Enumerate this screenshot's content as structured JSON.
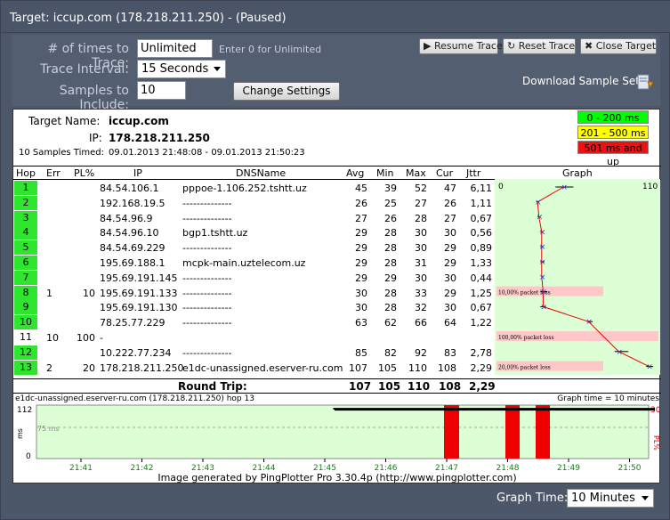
{
  "title": "Target: iccup.com (178.218.211.250) - (Paused)",
  "controls": {
    "times_label": "# of times to Trace:",
    "times_value": "Unlimited",
    "times_hint": "Enter 0 for Unlimited",
    "interval_label": "Trace Interval:",
    "interval_value": "15 Seconds",
    "samples_label": "Samples to Include:",
    "samples_value": "10",
    "change_settings": "Change Settings",
    "resume_trace": "Resume Trace",
    "reset_trace": "Reset Trace",
    "close_target": "Close Target",
    "download_sample": "Download Sample Set"
  },
  "header": {
    "target_name_label": "Target Name:",
    "target_name": "iccup.com",
    "ip_label": "IP:",
    "ip": "178.218.211.250",
    "samples_timed": "10 Samples Timed:",
    "time_range": "09.01.2013 21:48:08 - 09.01.2013 21:50:23",
    "legend": [
      "0 - 200 ms",
      "201 - 500 ms",
      "501 ms and up"
    ],
    "legend_colors": [
      "#00ff00",
      "#ffff00",
      "#ff0000"
    ]
  },
  "columns": [
    "Hop",
    "Err",
    "PL%",
    "IP",
    "DNSName",
    "Avg",
    "Min",
    "Max",
    "Cur",
    "Jttr",
    "Graph"
  ],
  "hops": [
    {
      "hop": "1",
      "err": "",
      "pl": "",
      "ip": "84.54.106.1",
      "dns": "pppoe-1.106.252.tshtt.uz",
      "avg": "45",
      "min": "39",
      "max": "52",
      "cur": "47",
      "jttr": "6,11",
      "ok": true
    },
    {
      "hop": "2",
      "err": "",
      "pl": "",
      "ip": "192.168.19.5",
      "dns": "--------------",
      "avg": "26",
      "min": "25",
      "max": "27",
      "cur": "26",
      "jttr": "1,11",
      "ok": true
    },
    {
      "hop": "3",
      "err": "",
      "pl": "",
      "ip": "84.54.96.9",
      "dns": "--------------",
      "avg": "27",
      "min": "26",
      "max": "28",
      "cur": "27",
      "jttr": "0,67",
      "ok": true
    },
    {
      "hop": "4",
      "err": "",
      "pl": "",
      "ip": "84.54.96.10",
      "dns": "bgp1.tshtt.uz",
      "avg": "29",
      "min": "28",
      "max": "30",
      "cur": "30",
      "jttr": "0,56",
      "ok": true
    },
    {
      "hop": "5",
      "err": "",
      "pl": "",
      "ip": "84.54.69.229",
      "dns": "--------------",
      "avg": "29",
      "min": "28",
      "max": "30",
      "cur": "29",
      "jttr": "0,89",
      "ok": true
    },
    {
      "hop": "6",
      "err": "",
      "pl": "",
      "ip": "195.69.188.1",
      "dns": "mcpk-main.uztelecom.uz",
      "avg": "29",
      "min": "28",
      "max": "31",
      "cur": "29",
      "jttr": "1,33",
      "ok": true
    },
    {
      "hop": "7",
      "err": "",
      "pl": "",
      "ip": "195.69.191.145",
      "dns": "--------------",
      "avg": "29",
      "min": "29",
      "max": "30",
      "cur": "30",
      "jttr": "0,44",
      "ok": true
    },
    {
      "hop": "8",
      "err": "1",
      "pl": "10",
      "ip": "195.69.191.133",
      "dns": "--------------",
      "avg": "30",
      "min": "28",
      "max": "33",
      "cur": "29",
      "jttr": "1,25",
      "ok": true
    },
    {
      "hop": "9",
      "err": "",
      "pl": "",
      "ip": "195.69.191.130",
      "dns": "--------------",
      "avg": "30",
      "min": "28",
      "max": "32",
      "cur": "30",
      "jttr": "0,67",
      "ok": true
    },
    {
      "hop": "10",
      "err": "",
      "pl": "",
      "ip": "78.25.77.229",
      "dns": "--------------",
      "avg": "63",
      "min": "62",
      "max": "66",
      "cur": "64",
      "jttr": "1,22",
      "ok": true
    },
    {
      "hop": "11",
      "err": "10",
      "pl": "100",
      "ip": "-",
      "dns": "",
      "avg": "",
      "min": "",
      "max": "",
      "cur": "",
      "jttr": "",
      "ok": false
    },
    {
      "hop": "12",
      "err": "",
      "pl": "",
      "ip": "10.222.77.234",
      "dns": "--------------",
      "avg": "85",
      "min": "82",
      "max": "92",
      "cur": "83",
      "jttr": "2,78",
      "ok": true
    },
    {
      "hop": "13",
      "err": "2",
      "pl": "20",
      "ip": "178.218.211.250",
      "dns": "e1dc-unassigned.eserver-ru.com",
      "avg": "107",
      "min": "105",
      "max": "110",
      "max_": "",
      "cur": "108",
      "jttr": "2,29",
      "ok": true
    }
  ],
  "graph": {
    "scale_min": "0",
    "scale_max": "110",
    "loss_labels": {
      "8": "10,00% packet loss",
      "11": "100,00% packet loss",
      "13": "20,00% packet loss"
    }
  },
  "round_trip": {
    "label": "Round Trip:",
    "avg": "107",
    "min": "105",
    "max": "110",
    "cur": "108",
    "jttr": "2,29"
  },
  "timeline": {
    "title": "e1dc-unassigned.eserver-ru.com (178.218.211.250) hop 13",
    "graph_time_label": "Graph time = 10 minutes",
    "y_top": "112",
    "y_ref": "75 ms",
    "y_zero": "0",
    "y_axis": "ms",
    "right_top": "30",
    "right_axis": "PL%",
    "times": [
      "21:41",
      "21:42",
      "21:43",
      "21:44",
      "21:45",
      "21:46",
      "21:47",
      "21:48",
      "21:49",
      "21:50"
    ],
    "footer": "Image generated by PingPlotter Pro 3.30.4p (http://www.pingplotter.com)"
  },
  "graph_time": {
    "label": "Graph Time:",
    "value": "10 Minutes"
  }
}
